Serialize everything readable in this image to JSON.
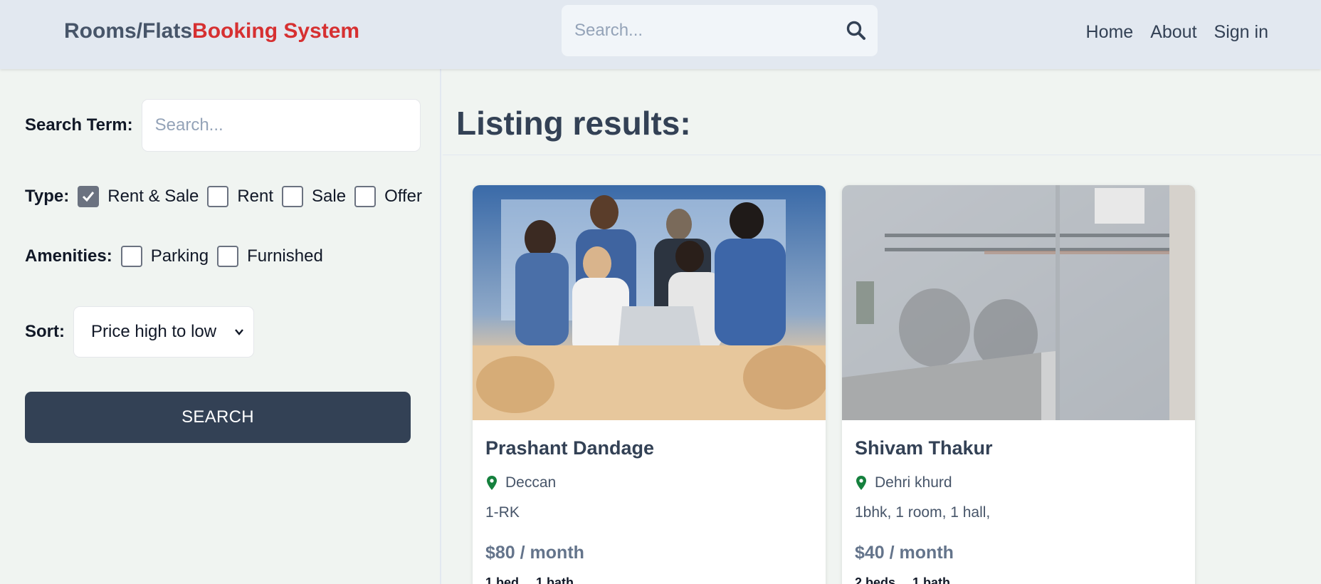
{
  "header": {
    "logo_part1": "Rooms/Flats",
    "logo_part2": "Booking System",
    "search_placeholder": "Search...",
    "nav": [
      "Home",
      "About",
      "Sign in"
    ]
  },
  "sidebar": {
    "search_term_label": "Search Term:",
    "search_term_placeholder": "Search...",
    "type_label": "Type:",
    "type_options": [
      {
        "label": "Rent & Sale",
        "checked": true
      },
      {
        "label": "Rent",
        "checked": false
      },
      {
        "label": "Sale",
        "checked": false
      },
      {
        "label": "Offer",
        "checked": false
      }
    ],
    "amenities_label": "Amenities:",
    "amenities_options": [
      {
        "label": "Parking",
        "checked": false
      },
      {
        "label": "Furnished",
        "checked": false
      }
    ],
    "sort_label": "Sort:",
    "sort_selected": "Price high to low",
    "search_button": "SEARCH"
  },
  "main": {
    "title": "Listing results:",
    "listings": [
      {
        "name": "Prashant Dandage",
        "location": "Deccan",
        "description": "1-RK",
        "price": "$80 / month",
        "beds": "1 bed",
        "baths": "1 bath"
      },
      {
        "name": "Shivam Thakur",
        "location": "Dehri khurd",
        "description": "1bhk, 1 room, 1 hall,",
        "price": "$40 / month",
        "beds": "2 beds",
        "baths": "1 bath"
      }
    ]
  },
  "colors": {
    "brand_red": "#d63031",
    "header_bg": "#e2e8f0",
    "page_bg": "#f0f4f1",
    "button_bg": "#334155",
    "pin_green": "#15803d"
  },
  "icons": [
    "search-icon",
    "check-icon",
    "chevron-down-icon",
    "map-pin-icon"
  ]
}
